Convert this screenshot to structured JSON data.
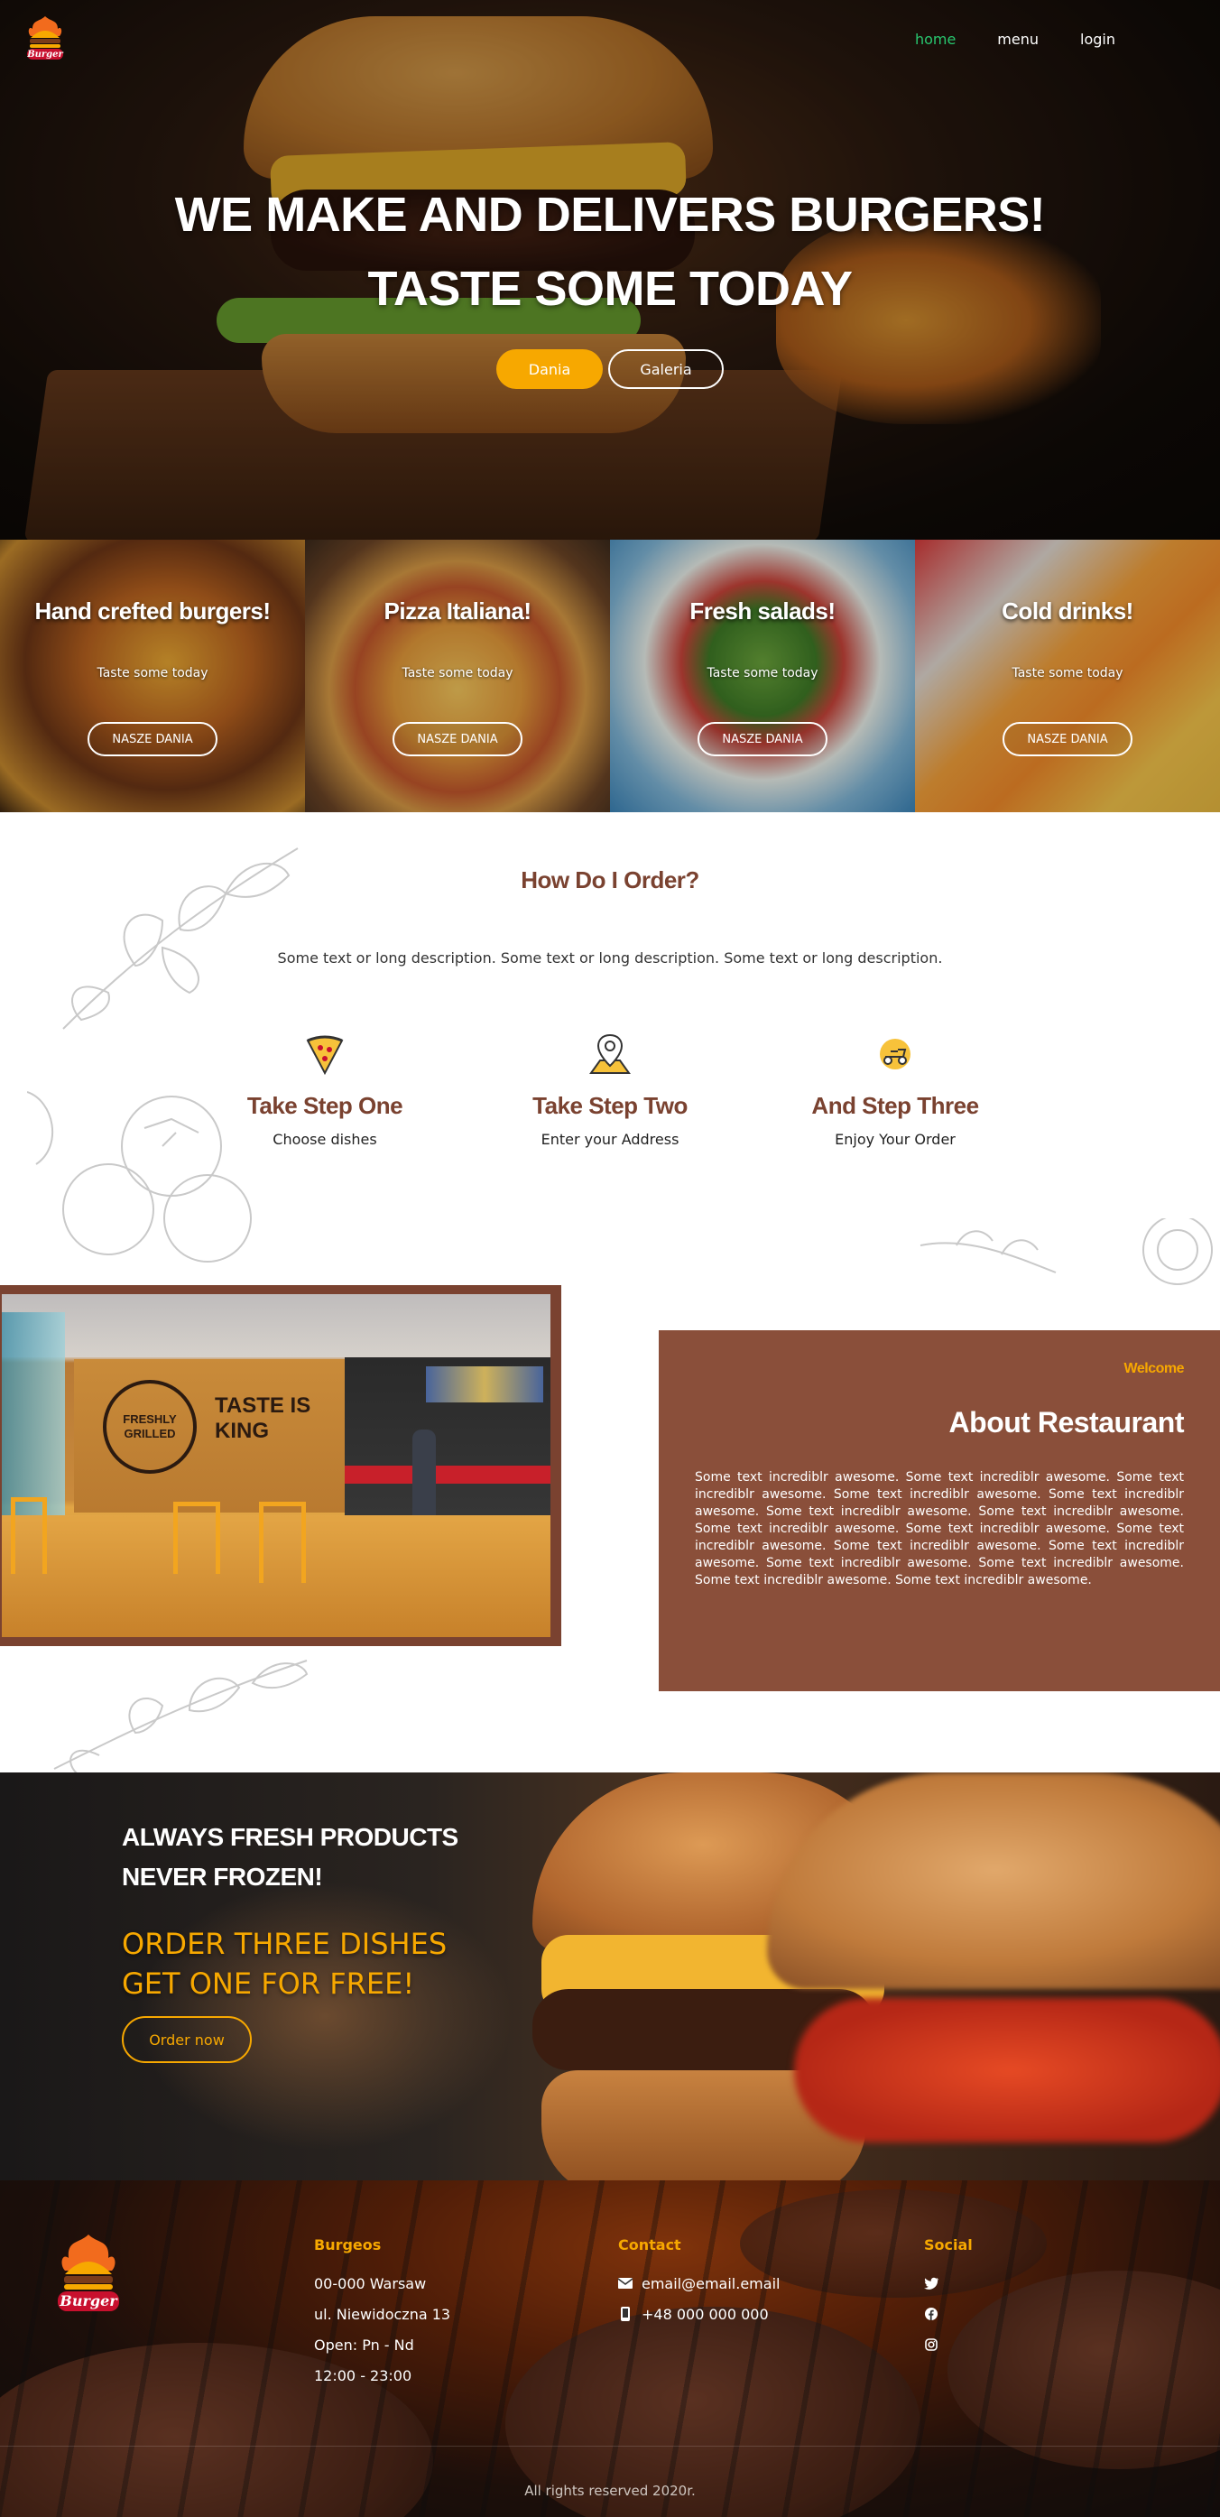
{
  "nav": {
    "items": [
      {
        "label": "home",
        "active": true
      },
      {
        "label": "menu",
        "active": false
      },
      {
        "label": "login",
        "active": false
      }
    ]
  },
  "logo": {
    "text": "Burger"
  },
  "hero": {
    "line1": "WE MAKE AND DELIVERS BURGERS!",
    "line2": "TASTE SOME TODAY",
    "btn_primary": "Dania",
    "btn_secondary": "Galeria"
  },
  "categories": [
    {
      "title": "Hand crefted burgers!",
      "subtitle": "Taste some today",
      "button": "NASZE DANIA"
    },
    {
      "title": "Pizza Italiana!",
      "subtitle": "Taste some today",
      "button": "NASZE DANIA"
    },
    {
      "title": "Fresh salads!",
      "subtitle": "Taste some today",
      "button": "NASZE DANIA"
    },
    {
      "title": "Cold drinks!",
      "subtitle": "Taste some today",
      "button": "NASZE DANIA"
    }
  ],
  "order": {
    "title": "How Do I Order?",
    "description": "Some text or long description. Some text or long description. Some text or long description.",
    "steps": [
      {
        "icon": "pizza-slice-icon",
        "title": "Take Step One",
        "text": "Choose dishes"
      },
      {
        "icon": "map-pin-icon",
        "title": "Take Step Two",
        "text": "Enter your Address"
      },
      {
        "icon": "delivery-scooter-icon",
        "title": "And Step Three",
        "text": "Enjoy Your Order"
      }
    ]
  },
  "about": {
    "kicker": "Welcome",
    "title": "About Restaurant",
    "body": "Some text incrediblr awesome. Some text incrediblr awesome. Some text incrediblr awesome. Some text incrediblr awesome. Some text incrediblr awesome. Some text incrediblr awesome. Some text incrediblr awesome. Some text incrediblr awesome. Some text incrediblr awesome. Some text incrediblr awesome. Some text incrediblr awesome. Some text incrediblr awesome. Some text incrediblr awesome. Some text incrediblr awesome. Some text incrediblr awesome. Some text incrediblr awesome.",
    "image_sign_1": "FRESHLY GRILLED",
    "image_sign_2": "TASTE IS KING"
  },
  "promo": {
    "line1": "ALWAYS FRESH PRODUCTS",
    "line2": "NEVER FROZEN!",
    "offer1": "ORDER THREE DISHES",
    "offer2": "GET ONE FOR FREE!",
    "button": "Order now"
  },
  "footer": {
    "address_title": "Burgeos",
    "address": [
      "00-000 Warsaw",
      "ul. Niewidoczna 13",
      "Open: Pn - Nd",
      "12:00 - 23:00"
    ],
    "contact_title": "Contact",
    "email": "email@email.email",
    "phone": "+48 000 000 000",
    "social_title": "Social",
    "social": [
      "twitter-icon",
      "facebook-icon",
      "instagram-icon"
    ],
    "copyright": "All rights reserved 2020r."
  },
  "colors": {
    "accent": "#f7a800",
    "brown": "#7a4230",
    "about_bg": "#8a4f3a",
    "nav_active": "#28c76f"
  }
}
